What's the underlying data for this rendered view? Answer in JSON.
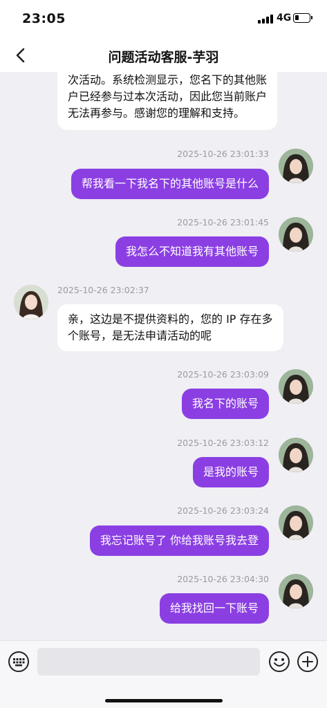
{
  "status_bar": {
    "time": "23:05",
    "network": "4G"
  },
  "header": {
    "title": "问题活动客服-芋羽"
  },
  "messages": [
    {
      "sender": "agent",
      "lines": [
        "次活动。系统检测显示，您名下的其他账",
        "户已经参与过本次活动，因此您当前账户",
        "无法再参与。感谢您的理解和支持。"
      ]
    },
    {
      "sender": "me",
      "time": "2025-10-26 23:01:33",
      "text": "帮我看一下我名下的其他账号是什么"
    },
    {
      "sender": "me",
      "time": "2025-10-26 23:01:45",
      "text": "我怎么不知道我有其他账号"
    },
    {
      "sender": "agent",
      "time": "2025-10-26 23:02:37",
      "lines": [
        "亲，这边是不提供资料的，您的 IP 存在多",
        "个账号，是无法申请活动的呢"
      ]
    },
    {
      "sender": "me",
      "time": "2025-10-26 23:03:09",
      "text": "我名下的账号"
    },
    {
      "sender": "me",
      "time": "2025-10-26 23:03:12",
      "text": "是我的账号"
    },
    {
      "sender": "me",
      "time": "2025-10-26 23:03:24",
      "text": "我忘记账号了 你给我账号我去登"
    },
    {
      "sender": "me",
      "time": "2025-10-26 23:04:30",
      "text": "给我找回一下账号"
    }
  ],
  "input_bar": {
    "placeholder": ""
  },
  "colors": {
    "accent": "#8b3fe3",
    "background": "#efeff4"
  }
}
